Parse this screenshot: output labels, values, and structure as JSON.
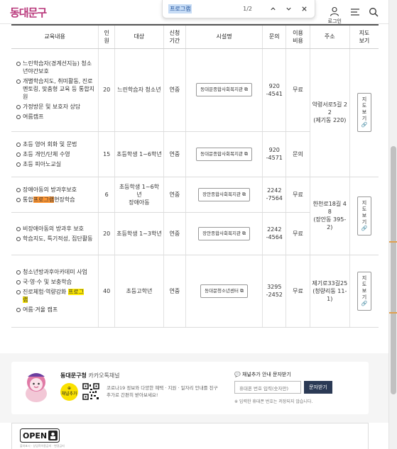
{
  "header": {
    "logo_text": "동대문구",
    "login_label": "로그인",
    "icons": [
      "user-icon",
      "menu-icon",
      "search-icon"
    ],
    "accent_color": "#b8367a"
  },
  "find_bar": {
    "query": "프로그램",
    "count": "1/2",
    "buttons": [
      "chevron-up-icon",
      "chevron-down-icon",
      "close-icon"
    ]
  },
  "table": {
    "headers": {
      "program": "교육내용",
      "capacity": [
        "인",
        "원"
      ],
      "target": "대상",
      "period": [
        "신청",
        "기간"
      ],
      "facility": "시설명",
      "contact": "문의",
      "fee": [
        "이용",
        "비용"
      ],
      "address": "주소",
      "map": [
        "지도",
        "보기"
      ]
    },
    "rows": [
      {
        "programs": [
          "느린학습자(경계선지능) 청소년야간보호",
          "개별학습지도, 취미활동, 진로멘토링, 맞춤형 교육 등 통합지원",
          "가정방문 및 보호자 상담",
          "여름캠프"
        ],
        "capacity": "20",
        "target": "느린학습자 청소년",
        "period": "연중",
        "facility": "동대문종합사회복지관",
        "contact": [
          "920",
          "-4541"
        ],
        "fee": "무료",
        "address": [
          "약령서로5길 2",
          "2",
          "(제기동 220)"
        ],
        "map": [
          "지",
          "도",
          "보",
          "기"
        ]
      },
      {
        "programs": [
          "초등 영어 회화 및 문법",
          "초등 개인/단체 수영",
          "초등 피아노교실"
        ],
        "capacity": "15",
        "target": "초등학생 1~6학년",
        "period": "연중",
        "facility": "동대문종합사회복지관",
        "contact": [
          "920",
          "-4571"
        ],
        "fee": "문의"
      },
      {
        "programs_parts": [
          "장애아동의 방과후보호",
          "통합",
          "프로그램",
          "현장학습"
        ],
        "capacity": "6",
        "target": [
          "초등학생 1~6학",
          "년",
          "장애아동"
        ],
        "period": "연중",
        "facility": "장안종합사회복지관",
        "contact": [
          "2242",
          "-7564"
        ],
        "fee": "무료",
        "address": [
          "한천로18길 4",
          "8",
          "(장안동 395-",
          "2)"
        ],
        "map": [
          "지",
          "도",
          "보",
          "기"
        ]
      },
      {
        "programs": [
          "비장애아동의 방과후 보호",
          "학습지도, 특기적성, 집단활동"
        ],
        "capacity": "20",
        "target": "초등학생 1~3학년",
        "period": "연중",
        "facility": "장안종합사회복지관",
        "contact": [
          "2242",
          "-4564"
        ],
        "fee": "무료"
      },
      {
        "programs": [
          "청소년방과후아카데미 사업",
          "국·영·수 및 보충학습"
        ],
        "program_parts": [
          "진로체험·역량강화 ",
          "프로그",
          "램"
        ],
        "program_last": "여름·겨울 캠프",
        "capacity": "40",
        "target": "초등고학년",
        "period": "연중",
        "facility": "동대문청소년센터",
        "contact": [
          "3295",
          "-2452"
        ],
        "fee": "무료",
        "address": [
          "제기로33길25",
          "(청량리동 11-",
          "1)"
        ],
        "map": [
          "지",
          "도",
          "보",
          "기"
        ]
      }
    ]
  },
  "kakao": {
    "org": "동대문구청",
    "channel": "카카오톡채널",
    "add_label": [
      "채널",
      "추가"
    ],
    "desc": "코로나19 정보와 다양한 혜택 · 지원 · 일자리 안내를 친구추가로 간편히 받아보세요!",
    "sub_title": "채널추가 안내 문자받기",
    "input_placeholder": "휴대폰 번호 입력(숫자만)",
    "button_label": "문자받기",
    "note": "※ 입력한 휴대폰 번호는 저장되지 않습니다."
  },
  "open_license": {
    "logo_text": "OPEN",
    "sub": "출처표시 · 상업적이용금지 · 변경금지"
  }
}
